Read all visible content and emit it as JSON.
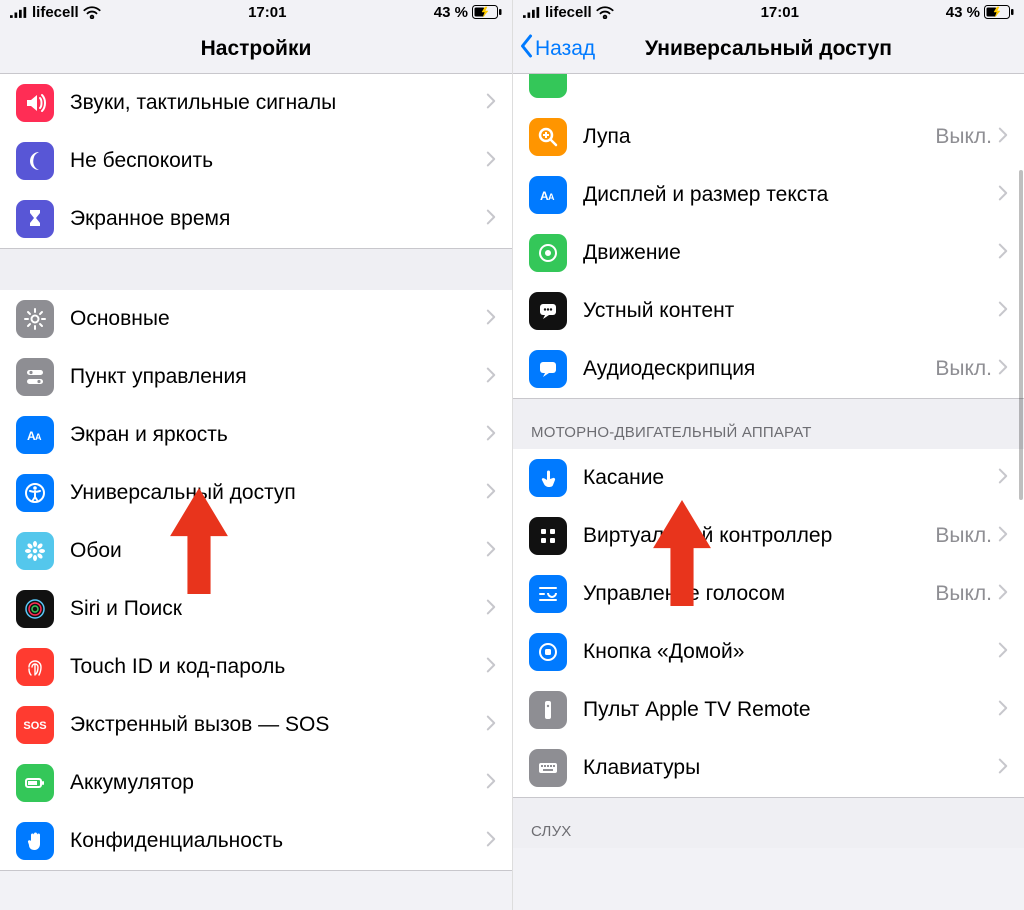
{
  "status": {
    "carrier": "lifecell",
    "time": "17:01",
    "battery": "43 %"
  },
  "left": {
    "title": "Настройки",
    "group1": [
      {
        "label": "Звуки, тактильные сигналы",
        "icon": "sounds",
        "bg": "#ff2d55"
      },
      {
        "label": "Не беспокоить",
        "icon": "moon",
        "bg": "#5856d6"
      },
      {
        "label": "Экранное время",
        "icon": "hourglass",
        "bg": "#5856d6"
      }
    ],
    "group2": [
      {
        "label": "Основные",
        "icon": "gear",
        "bg": "#8e8e93"
      },
      {
        "label": "Пункт управления",
        "icon": "switches",
        "bg": "#8e8e93"
      },
      {
        "label": "Экран и яркость",
        "icon": "aa",
        "bg": "#007aff"
      },
      {
        "label": "Универсальный доступ",
        "icon": "access",
        "bg": "#007aff"
      },
      {
        "label": "Обои",
        "icon": "flower",
        "bg": "#54c7ec"
      },
      {
        "label": "Siri и Поиск",
        "icon": "siri",
        "bg": "#111"
      },
      {
        "label": "Touch ID и код-пароль",
        "icon": "fingerprint",
        "bg": "#ff3b30"
      },
      {
        "label": "Экстренный вызов — SOS",
        "icon": "sos",
        "bg": "#ff3b30"
      },
      {
        "label": "Аккумулятор",
        "icon": "battery",
        "bg": "#34c759"
      },
      {
        "label": "Конфиденциальность",
        "icon": "hand",
        "bg": "#007aff"
      }
    ]
  },
  "right": {
    "back": "Назад",
    "title": "Универсальный доступ",
    "group1": [
      {
        "label": "Лупа",
        "icon": "zoom",
        "bg": "#ff9500",
        "detail": "Выкл."
      },
      {
        "label": "Дисплей и размер текста",
        "icon": "aa",
        "bg": "#007aff"
      },
      {
        "label": "Движение",
        "icon": "motion",
        "bg": "#34c759"
      },
      {
        "label": "Устный контент",
        "icon": "speech",
        "bg": "#111"
      },
      {
        "label": "Аудиодескрипция",
        "icon": "ad",
        "bg": "#007aff",
        "detail": "Выкл."
      }
    ],
    "section2_header": "МОТОРНО-ДВИГАТЕЛЬНЫЙ АППАРАТ",
    "group2": [
      {
        "label": "Касание",
        "icon": "touch",
        "bg": "#007aff"
      },
      {
        "label": "Виртуальный контроллер",
        "icon": "grid",
        "bg": "#111",
        "detail": "Выкл."
      },
      {
        "label": "Управление голосом",
        "icon": "voice",
        "bg": "#007aff",
        "detail": "Выкл."
      },
      {
        "label": "Кнопка «Домой»",
        "icon": "home",
        "bg": "#007aff"
      },
      {
        "label": "Пульт Apple TV Remote",
        "icon": "remote",
        "bg": "#8e8e93"
      },
      {
        "label": "Клавиатуры",
        "icon": "keyboard",
        "bg": "#8e8e93"
      }
    ],
    "section3_header": "СЛУХ"
  }
}
